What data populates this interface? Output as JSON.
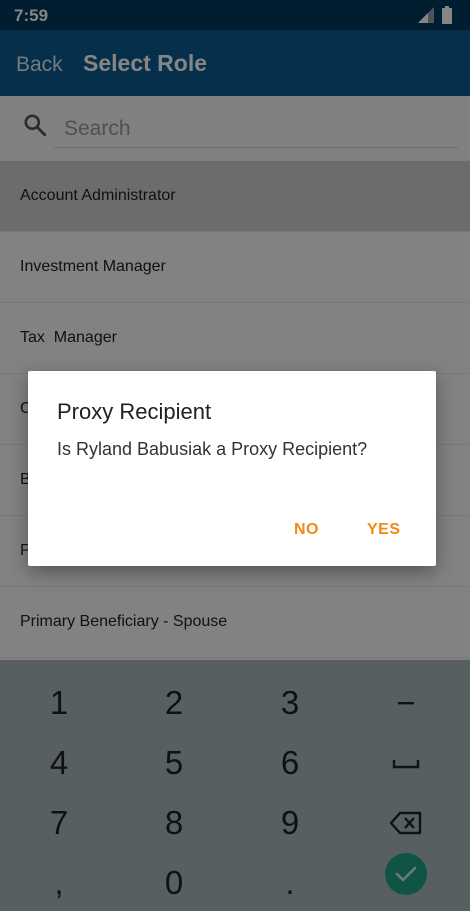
{
  "status_bar": {
    "time": "7:59"
  },
  "app_bar": {
    "back_label": "Back",
    "title": "Select Role"
  },
  "search": {
    "placeholder": "Search",
    "value": ""
  },
  "roles": [
    {
      "label": "Account Administrator",
      "selected": true
    },
    {
      "label": "Investment Manager"
    },
    {
      "label": "Tax  Manager"
    },
    {
      "label": "C"
    },
    {
      "label": "B"
    },
    {
      "label": "P"
    },
    {
      "label": "Primary Beneficiary - Spouse"
    }
  ],
  "dialog": {
    "title": "Proxy Recipient",
    "message": "Is Ryland Babusiak a Proxy Recipient?",
    "no_label": "NO",
    "yes_label": "YES",
    "button_color": "#f18a14"
  },
  "keyboard": {
    "keys": [
      "1",
      "2",
      "3",
      "−",
      "4",
      "5",
      "6",
      "space",
      "7",
      "8",
      "9",
      "backspace",
      ",",
      "0",
      ".",
      "done"
    ],
    "icons": {
      "space": "space-bar-icon",
      "backspace": "backspace-icon",
      "done": "checkmark-icon"
    },
    "accent_color": "#1fa284"
  },
  "colors": {
    "status_bar": "#003a5c",
    "app_bar": "#0a5b8e",
    "keyboard_bg": "#aab6bb"
  }
}
